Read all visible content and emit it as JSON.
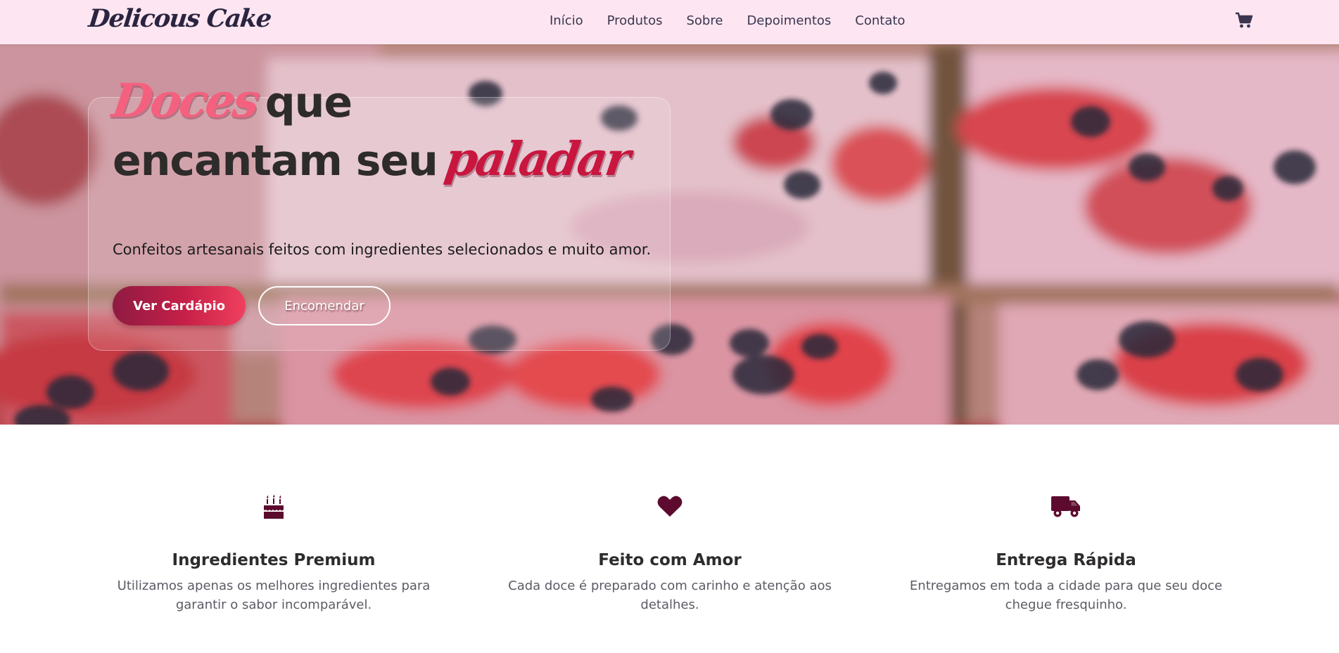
{
  "nav": {
    "logo": "Delicous Cake",
    "links": [
      "Início",
      "Produtos",
      "Sobre",
      "Depoimentos",
      "Contato"
    ],
    "cart_icon": "shopping-cart-icon"
  },
  "hero": {
    "headline_script_1": "Doces",
    "headline_part_1": "que",
    "headline_part_2": "encantam seu",
    "headline_script_2": "paladar",
    "subtitle": "Confeitos artesanais feitos com ingredientes selecionados e muito amor.",
    "primary_button": "Ver Cardápio",
    "secondary_button": "Encomendar"
  },
  "features": [
    {
      "icon": "birthday-cake-icon",
      "title": "Ingredientes Premium",
      "line1": "Utilizamos apenas os melhores ingredientes para",
      "line2": "garantir o sabor incomparável."
    },
    {
      "icon": "heart-icon",
      "title": "Feito com Amor",
      "line1": "Cada doce é preparado com carinho e atenção aos",
      "line2": "detalhes."
    },
    {
      "icon": "truck-icon",
      "title": "Entrega Rápida",
      "line1": "Entregamos em toda a cidade para que seu doce",
      "line2": "chegue fresquinho."
    }
  ],
  "colors": {
    "nav_bg": "#fde6f1",
    "accent_pink": "#f4617f",
    "accent_crimson": "#c8163f",
    "icon_color": "#5c0b2e"
  }
}
